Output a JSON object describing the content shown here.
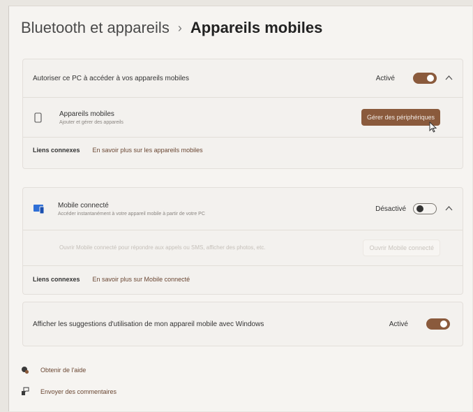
{
  "breadcrumb": {
    "parent": "Bluetooth et appareils",
    "separator": "›",
    "current": "Appareils mobiles"
  },
  "colors": {
    "accent": "#8a5a3c",
    "background": "#f6f4f1",
    "card": "#f3f1ee"
  },
  "card1": {
    "header_label": "Autoriser ce PC à accéder à vos appareils mobiles",
    "status": "Activé",
    "toggle_on": true,
    "device": {
      "icon": "phone-icon",
      "title": "Appareils mobiles",
      "subtitle": "Ajouter et gérer des appareils",
      "button": "Gérer des périphériques"
    },
    "related_label": "Liens connexes",
    "related_link": "En savoir plus sur les appareils mobiles"
  },
  "card2": {
    "icon": "phone-link-icon",
    "title": "Mobile connecté",
    "subtitle": "Accéder instantanément à votre appareil mobile à partir de votre PC",
    "status": "Désactivé",
    "toggle_on": false,
    "disabled_text": "Ouvrir Mobile connecté pour répondre aux appels ou SMS, afficher des photos, etc.",
    "disabled_button": "Ouvrir Mobile connecté",
    "related_label": "Liens connexes",
    "related_link": "En savoir plus sur Mobile connecté"
  },
  "card3": {
    "label": "Afficher les suggestions d'utilisation de mon appareil mobile avec Windows",
    "status": "Activé",
    "toggle_on": true
  },
  "footer": {
    "help": {
      "icon": "help-icon",
      "label": "Obtenir de l'aide"
    },
    "feedback": {
      "icon": "feedback-icon",
      "label": "Envoyer des commentaires"
    }
  }
}
